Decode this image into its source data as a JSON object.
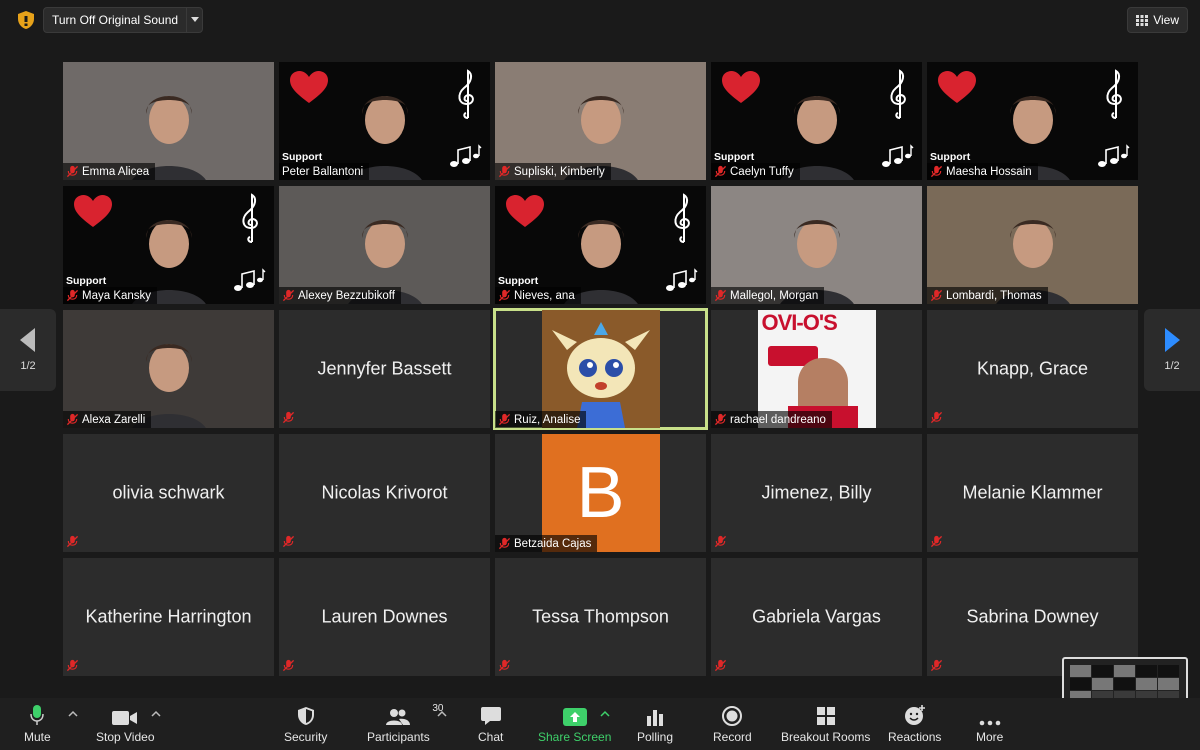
{
  "top": {
    "sound_button": "Turn Off Original Sound",
    "view_button": "View",
    "shield_color": "#e7a21a"
  },
  "tiles": [
    {
      "name": "Emma Alicea",
      "type": "video",
      "bg": "#6f6a68",
      "muted": true
    },
    {
      "name": "Peter Ballantoni",
      "type": "music",
      "support": "Support",
      "muted": false
    },
    {
      "name": "Supliski, Kimberly",
      "type": "video",
      "bg": "#8a7d74",
      "muted": true
    },
    {
      "name": "Caelyn Tuffy",
      "type": "music",
      "support": "Support",
      "muted": true
    },
    {
      "name": "Maesha Hossain",
      "type": "music",
      "support": "Support",
      "muted": true
    },
    {
      "name": "Maya Kansky",
      "type": "music",
      "support": "Support",
      "muted": true
    },
    {
      "name": "Alexey Bezzubikoff",
      "type": "video",
      "bg": "#5d5a58",
      "muted": true
    },
    {
      "name": "Nieves, ana",
      "type": "music",
      "support": "Support",
      "muted": true
    },
    {
      "name": "Mallegol, Morgan",
      "type": "video",
      "bg": "#8c8683",
      "muted": true
    },
    {
      "name": "Lombardi, Thomas",
      "type": "video",
      "bg": "#7a6a58",
      "muted": true
    },
    {
      "name": "Alexa Zarelli",
      "type": "video",
      "bg": "#3e3a38",
      "muted": true
    },
    {
      "name": "Jennyfer Bassett",
      "type": "blank",
      "muted": true
    },
    {
      "name": "Ruiz, Analise",
      "type": "cartoon",
      "muted": true,
      "active": true
    },
    {
      "name": "rachael dandreano",
      "type": "cereal",
      "muted": true,
      "cereal_text": "OVI-O'S"
    },
    {
      "name": "Knapp, Grace",
      "type": "blank",
      "muted": true
    },
    {
      "name": "olivia schwark",
      "type": "blank",
      "muted": true
    },
    {
      "name": "Nicolas Krivorot",
      "type": "blank",
      "muted": true
    },
    {
      "name": "Betzaida Cajas",
      "type": "letter",
      "letter": "B",
      "muted": true
    },
    {
      "name": "Jimenez, Billy",
      "type": "blank",
      "muted": true
    },
    {
      "name": "Melanie Klammer",
      "type": "blank",
      "muted": true
    },
    {
      "name": "Katherine Harrington",
      "type": "blank",
      "muted": true
    },
    {
      "name": "Lauren Downes",
      "type": "blank",
      "muted": true
    },
    {
      "name": "Tessa Thompson",
      "type": "blank",
      "muted": true
    },
    {
      "name": "Gabriela Vargas",
      "type": "blank",
      "muted": true
    },
    {
      "name": "Sabrina Downey",
      "type": "blank",
      "muted": true
    }
  ],
  "pagination": {
    "left": "1/2",
    "right": "1/2"
  },
  "toolbar": {
    "mute": "Mute",
    "stop_video": "Stop Video",
    "security": "Security",
    "participants": "Participants",
    "participant_count": "30",
    "chat": "Chat",
    "share_screen": "Share Screen",
    "polling": "Polling",
    "record": "Record",
    "breakout": "Breakout Rooms",
    "reactions": "Reactions",
    "more": "More",
    "accent_green": "#3ed06a"
  }
}
